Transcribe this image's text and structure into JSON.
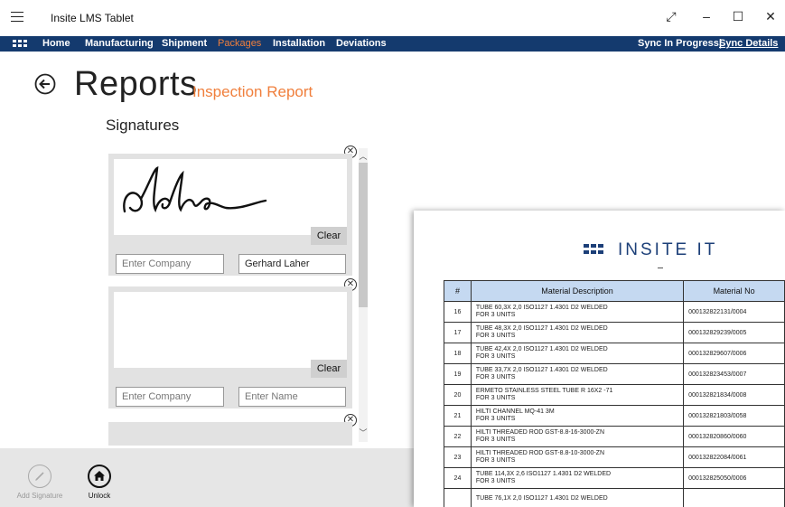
{
  "window": {
    "title": "Insite LMS Tablet"
  },
  "nav": {
    "items": [
      "Home",
      "Manufacturing",
      "Shipment",
      "Packages",
      "Installation",
      "Deviations"
    ],
    "active": "Packages",
    "sync_status": "Sync In Progress|",
    "sync_details": "Sync Details"
  },
  "header": {
    "title": "Reports",
    "subtitle": "Inspection Report"
  },
  "signatures": {
    "heading": "Signatures",
    "clear_label": "Clear",
    "cards": [
      {
        "company_value": "",
        "company_placeholder": "Enter Company",
        "name_value": "Gerhard Laher",
        "name_placeholder": "Enter Name",
        "signed": true
      },
      {
        "company_value": "",
        "company_placeholder": "Enter Company",
        "name_value": "",
        "name_placeholder": "Enter Name",
        "signed": false
      }
    ]
  },
  "appbar": {
    "add_signature": "Add Signature",
    "unlock": "Unlock"
  },
  "report": {
    "brand": "INSITE IT",
    "columns": [
      "#",
      "Material Description",
      "Material No"
    ],
    "rows": [
      {
        "no": "16",
        "desc1": "TUBE  60,3X 2,0 ISO1127 1.4301 D2 WELDED",
        "desc2": "FOR 3 UNITS",
        "mat": "000132822131/0004"
      },
      {
        "no": "17",
        "desc1": "TUBE  48,3X 2,0 ISO1127 1.4301 D2 WELDED",
        "desc2": "FOR 3 UNITS",
        "mat": "000132829239/0005"
      },
      {
        "no": "18",
        "desc1": "TUBE  42,4X 2,0 ISO1127 1.4301 D2 WELDED",
        "desc2": "FOR 3 UNITS",
        "mat": "000132829607/0006"
      },
      {
        "no": "19",
        "desc1": "TUBE  33,7X 2,0 ISO1127 1.4301 D2 WELDED",
        "desc2": "FOR 3 UNITS",
        "mat": "000132823453/0007"
      },
      {
        "no": "20",
        "desc1": "ERMETO STAINLESS STEEL TUBE R 16X2  -71",
        "desc2": "FOR 3 UNITS",
        "mat": "000132821834/0008"
      },
      {
        "no": "21",
        "desc1": "HILTI CHANNEL MQ-41   3M",
        "desc2": "FOR 3 UNITS",
        "mat": "000132821803/0058"
      },
      {
        "no": "22",
        "desc1": "HILTI THREADED ROD GST-8.8-16-3000-ZN",
        "desc2": "FOR 3 UNITS",
        "mat": "000132820860/0060"
      },
      {
        "no": "23",
        "desc1": "HILTI THREADED ROD GST-8.8-10-3000-ZN",
        "desc2": "FOR 3 UNITS",
        "mat": "000132822084/0061"
      },
      {
        "no": "24",
        "desc1": "TUBE 114,3X 2,6 ISO1127 1.4301 D2 WELDED",
        "desc2": "FOR 3 UNITS",
        "mat": "000132825050/0006"
      },
      {
        "no": "",
        "desc1": "TUBE  76,1X 2,0 ISO1127 1.4301 D2 WELDED",
        "desc2": "",
        "mat": ""
      }
    ]
  }
}
